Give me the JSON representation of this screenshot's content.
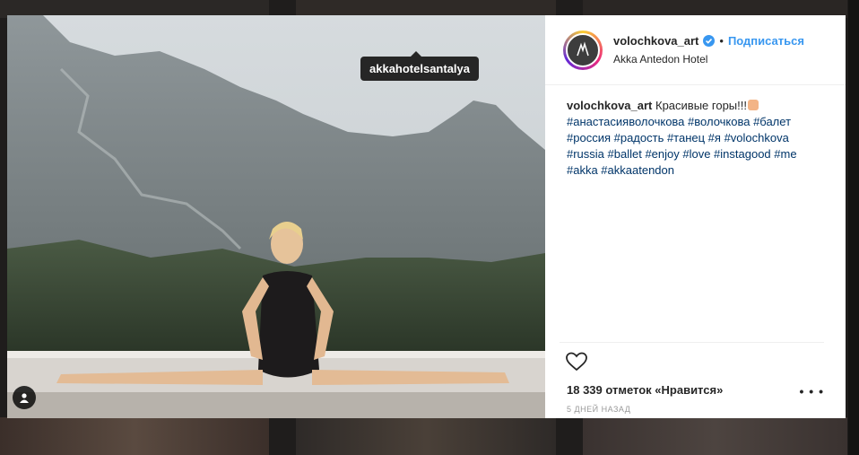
{
  "post": {
    "username": "volochkova_art",
    "separator": "•",
    "follow_label": "Подписаться",
    "location": "Akka Antedon Hotel",
    "photo_tag": "akkahotelsantalya",
    "caption_user": "volochkova_art",
    "caption_text": "Красивые горы!!!",
    "hashtags_line1": "#анастасияволочкова #волочкова #балет",
    "hashtags_line2": "#россия #радость #танец #я #volochkova",
    "hashtags_line3": "#russia #ballet #enjoy #love #instagood #me",
    "hashtags_line4": "#akka #akkaatendon",
    "likes": "18 339 отметок «Нравится»",
    "more_label": "• • •",
    "time": "5 ДНЕЙ НАЗАД"
  },
  "icons": {
    "verified": "verified-badge-icon",
    "heart": "heart-icon",
    "user_tags": "user-tags-icon"
  },
  "colors": {
    "link": "#3897f0",
    "hashtag": "#003569"
  }
}
